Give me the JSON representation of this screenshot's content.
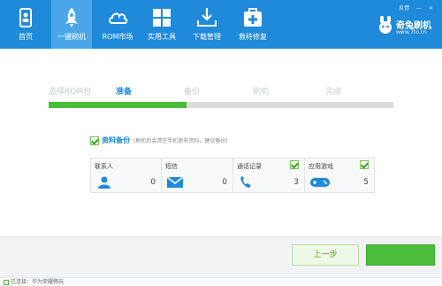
{
  "nav": {
    "items": [
      {
        "label": "首页",
        "icon": "phone-icon",
        "active": false
      },
      {
        "label": "一键刷机",
        "icon": "rocket-icon",
        "active": true
      },
      {
        "label": "ROM市场",
        "icon": "cloud-icon",
        "active": false
      },
      {
        "label": "实用工具",
        "icon": "grid-icon",
        "active": false
      },
      {
        "label": "下载管理",
        "icon": "download-icon",
        "active": false
      },
      {
        "label": "救砖修复",
        "icon": "medkit-icon",
        "active": false
      }
    ],
    "top_links": [
      "反馈"
    ]
  },
  "brand": {
    "name": "奇兔刷机",
    "url": "www.7to.cn"
  },
  "steps": {
    "items": [
      "选择ROM包",
      "准备",
      "备份",
      "刷机",
      "完成"
    ],
    "current_index": 1
  },
  "progress": {
    "fraction": 0.4
  },
  "backup": {
    "title": "资料备份",
    "note": "(刷机后会清空手机原有资料，建议备份)",
    "checked": true,
    "categories": [
      {
        "name": "联系人",
        "count": "0",
        "icon": "person-icon",
        "checked": false
      },
      {
        "name": "短信",
        "count": "0",
        "icon": "envelope-icon",
        "checked": false
      },
      {
        "name": "通话记录",
        "count": "3",
        "icon": "phone-call-icon",
        "checked": true
      },
      {
        "name": "应用游戏",
        "count": "5",
        "icon": "gamepad-icon",
        "checked": true
      }
    ]
  },
  "buttons": {
    "prev_label": "上一步",
    "next_label": ""
  },
  "status": {
    "text": "已连接：华为荣耀畅玩"
  },
  "colors": {
    "brand_blue": "#1f8ad9",
    "active_tab": "#4aa6e8",
    "progress_green": "#4cbd3a"
  }
}
